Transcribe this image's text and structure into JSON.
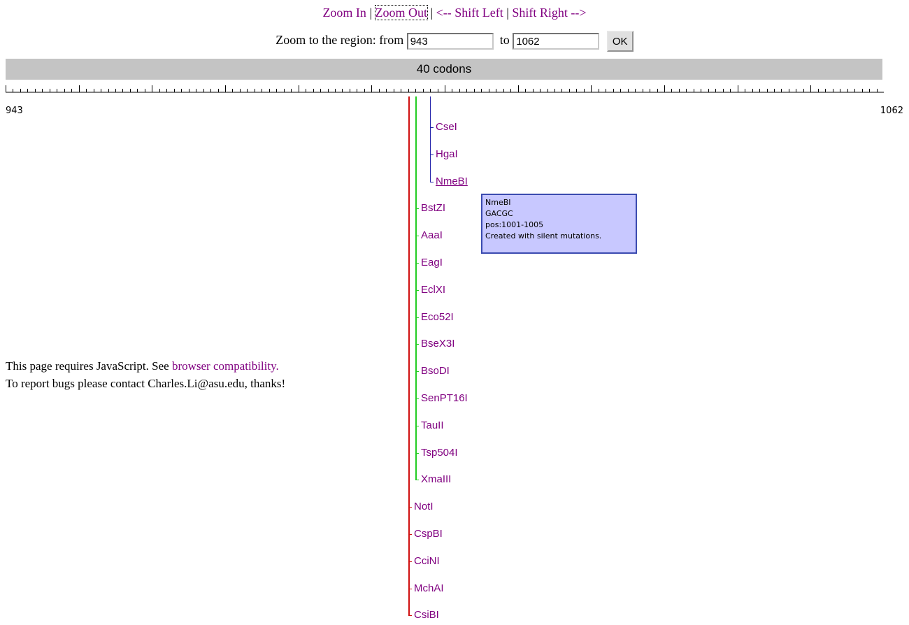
{
  "nav": {
    "zoom_in": "Zoom In",
    "zoom_out": "Zoom Out",
    "shift_left": "<-- Shift Left",
    "shift_right": "Shift Right -->",
    "separator": " | "
  },
  "zoom_form": {
    "label": "Zoom to the region: from",
    "from_value": "943",
    "to_label": "to",
    "to_value": "1062",
    "ok_label": "OK"
  },
  "codon_bar": {
    "label": "40 codons"
  },
  "ruler": {
    "start_label": "943",
    "end_label": "1062"
  },
  "enzymes": [
    {
      "name": "CseI",
      "group": "blue",
      "label": "CseI"
    },
    {
      "name": "HgaI",
      "group": "blue",
      "label": "HgaI"
    },
    {
      "name": "NmeBI",
      "group": "blue",
      "label": "NmeBI",
      "underlined": true
    },
    {
      "name": "BstZI",
      "group": "green",
      "label": "BstZI"
    },
    {
      "name": "AaaI",
      "group": "green",
      "label": "AaaI"
    },
    {
      "name": "EagI",
      "group": "green",
      "label": "EagI"
    },
    {
      "name": "EclXI",
      "group": "green",
      "label": "EclXI"
    },
    {
      "name": "Eco52I",
      "group": "green",
      "label": "Eco52I"
    },
    {
      "name": "BseX3I",
      "group": "green",
      "label": "BseX3I"
    },
    {
      "name": "BsoDI",
      "group": "green",
      "label": "BsoDI"
    },
    {
      "name": "SenPT16I",
      "group": "green",
      "label": "SenPT16I"
    },
    {
      "name": "TauII",
      "group": "green",
      "label": "TauII"
    },
    {
      "name": "Tsp504I",
      "group": "green",
      "label": "Tsp504I"
    },
    {
      "name": "XmaIII",
      "group": "green",
      "label": "XmaIII"
    },
    {
      "name": "NotI",
      "group": "red",
      "label": "NotI"
    },
    {
      "name": "CspBI",
      "group": "red",
      "label": "CspBI"
    },
    {
      "name": "CciNI",
      "group": "red",
      "label": "CciNI"
    },
    {
      "name": "MchAI",
      "group": "red",
      "label": "MchAI"
    },
    {
      "name": "CsiBI",
      "group": "red",
      "label": "CsiBI"
    }
  ],
  "tooltip": {
    "name": "NmeBI",
    "sequence": "GACGC",
    "position": "pos:1001-1005",
    "note": "Created with silent mutations."
  },
  "footer": {
    "line1_prefix": "This page requires JavaScript. See ",
    "compat_link": "browser compatibility.",
    "line2": "To report bugs please contact Charles.Li@asu.edu, thanks!"
  },
  "colors": {
    "link": "#800080",
    "codon_bar": "#c4c4c4",
    "red_line": "#d01010",
    "green_line": "#22cc22",
    "blue_line": "#2222aa",
    "tooltip_bg": "#c8c8ff",
    "tooltip_border": "#3b4bb0"
  }
}
